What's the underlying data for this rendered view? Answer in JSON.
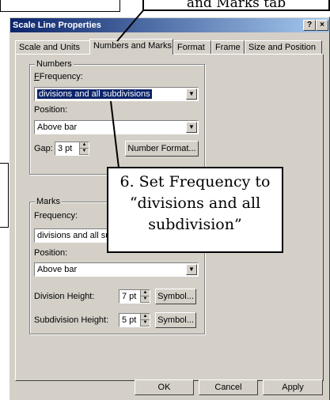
{
  "callouts": {
    "top_text": "and Marks tab",
    "step_line1": "6. Set Frequency to",
    "step_line2": "“divisions and all",
    "step_line3": "subdivision”"
  },
  "dialog": {
    "title": "Scale Line Properties",
    "help_btn": "?",
    "close_btn": "×",
    "tabs": [
      "Scale and Units",
      "Numbers and Marks",
      "Format",
      "Frame",
      "Size and Position"
    ],
    "numbers": {
      "legend": "Numbers",
      "frequency_label": "Frequency:",
      "frequency_value": "divisions and all subdivisions",
      "position_label": "Position:",
      "position_value": "Above bar",
      "gap_label": "Gap:",
      "gap_value": "3 pt",
      "number_format_btn": "Number Format..."
    },
    "marks": {
      "legend": "Marks",
      "frequency_label": "Frequency:",
      "frequency_value": "divisions and all su",
      "position_label": "Position:",
      "position_value": "Above bar",
      "division_height_label": "Division Height:",
      "division_height_value": "7 pt",
      "subdivision_height_label": "Subdivision Height:",
      "subdivision_height_value": "5 pt",
      "symbol_btn": "Symbol..."
    },
    "footer": {
      "ok": "OK",
      "cancel": "Cancel",
      "apply": "Apply"
    }
  }
}
